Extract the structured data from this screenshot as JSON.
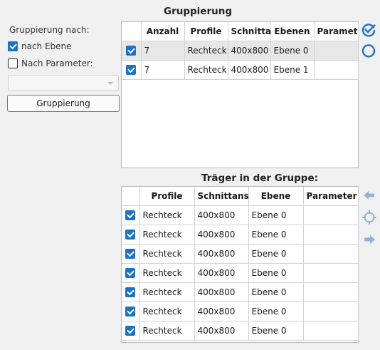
{
  "left_panel": {
    "group_by_label": "Gruppierung nach:",
    "opt_level": "nach Ebene",
    "opt_param": "Nach Parameter:",
    "param_select_value": "",
    "group_button": "Gruppierung"
  },
  "groups": {
    "title": "Gruppierung",
    "headers": [
      "Anzahl",
      "Profile",
      "Schnitta",
      "Ebenen",
      "Paramet"
    ],
    "rows": [
      {
        "checked": true,
        "cells": [
          "7",
          "Rechteck",
          "400x800",
          "Ebene 0",
          ""
        ]
      },
      {
        "checked": true,
        "cells": [
          "7",
          "Rechteck",
          "400x800",
          "Ebene 1",
          ""
        ]
      }
    ]
  },
  "members": {
    "title": "Träger in der Gruppe:",
    "headers": [
      "Profile",
      "Schnittansi",
      "Ebene",
      "Parameter"
    ],
    "rows": [
      {
        "checked": true,
        "cells": [
          "Rechteck",
          "400x800",
          "Ebene 0",
          ""
        ]
      },
      {
        "checked": true,
        "cells": [
          "Rechteck",
          "400x800",
          "Ebene 0",
          ""
        ]
      },
      {
        "checked": true,
        "cells": [
          "Rechteck",
          "400x800",
          "Ebene 0",
          ""
        ]
      },
      {
        "checked": true,
        "cells": [
          "Rechteck",
          "400x800",
          "Ebene 0",
          ""
        ]
      },
      {
        "checked": true,
        "cells": [
          "Rechteck",
          "400x800",
          "Ebene 0",
          ""
        ]
      },
      {
        "checked": true,
        "cells": [
          "Rechteck",
          "400x800",
          "Ebene 0",
          ""
        ]
      },
      {
        "checked": true,
        "cells": [
          "Rechteck",
          "400x800",
          "Ebene 0",
          ""
        ]
      }
    ]
  },
  "side_icons": {
    "check_all": "check-all-icon",
    "uncheck_all": "uncheck-all-icon",
    "back": "arrow-left-icon",
    "locate": "crosshair-icon",
    "forward": "arrow-right-icon"
  },
  "colors": {
    "accent": "#1a73c9",
    "icon_blue": "#1f73c7",
    "icon_light": "#8fb4dc",
    "selected_row": "#e7e7e7"
  }
}
